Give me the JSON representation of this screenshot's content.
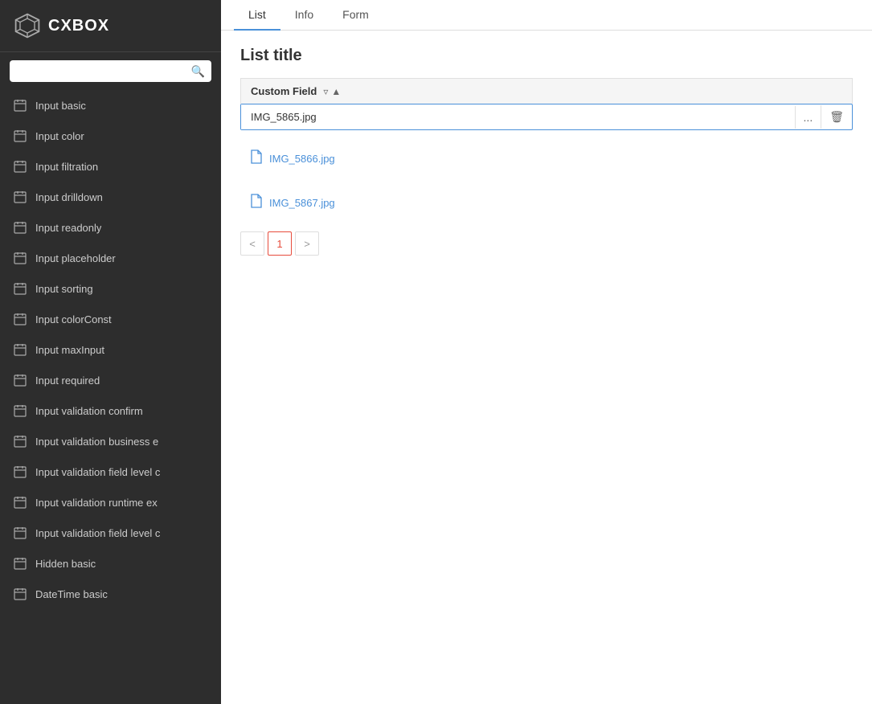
{
  "sidebar": {
    "logo_text": "CXBOX",
    "search_placeholder": "",
    "nav_items": [
      {
        "id": "input-basic",
        "label": "Input basic",
        "active": false
      },
      {
        "id": "input-color",
        "label": "Input color",
        "active": false
      },
      {
        "id": "input-filtration",
        "label": "Input filtration",
        "active": false
      },
      {
        "id": "input-drilldown",
        "label": "Input drilldown",
        "active": false
      },
      {
        "id": "input-readonly",
        "label": "Input readonly",
        "active": false
      },
      {
        "id": "input-placeholder",
        "label": "Input placeholder",
        "active": false
      },
      {
        "id": "input-sorting",
        "label": "Input sorting",
        "active": false
      },
      {
        "id": "input-colorconst",
        "label": "Input colorConst",
        "active": false
      },
      {
        "id": "input-maxinput",
        "label": "Input maxInput",
        "active": false
      },
      {
        "id": "input-required",
        "label": "Input required",
        "active": false
      },
      {
        "id": "input-validation-confirm",
        "label": "Input validation confirm",
        "active": false
      },
      {
        "id": "input-validation-business",
        "label": "Input validation business e",
        "active": false
      },
      {
        "id": "input-validation-field-1",
        "label": "Input validation field level c",
        "active": false
      },
      {
        "id": "input-validation-runtime",
        "label": "Input validation runtime ex",
        "active": false
      },
      {
        "id": "input-validation-field-2",
        "label": "Input validation field level c",
        "active": false
      },
      {
        "id": "hidden-basic",
        "label": "Hidden basic",
        "active": false
      },
      {
        "id": "datetime-basic",
        "label": "DateTime basic",
        "active": false
      }
    ]
  },
  "tabs": [
    {
      "id": "list",
      "label": "List",
      "active": true
    },
    {
      "id": "info",
      "label": "Info",
      "active": false
    },
    {
      "id": "form",
      "label": "Form",
      "active": false
    }
  ],
  "content": {
    "page_title": "List title",
    "column_header": "Custom Field",
    "file_edit": {
      "name": "IMG_5865.jpg",
      "btn_more": "...",
      "btn_delete": "🗑"
    },
    "file_links": [
      {
        "name": "IMG_5866.jpg"
      },
      {
        "name": "IMG_5867.jpg"
      }
    ],
    "pagination": {
      "prev": "<",
      "next": ">",
      "current": "1"
    }
  }
}
